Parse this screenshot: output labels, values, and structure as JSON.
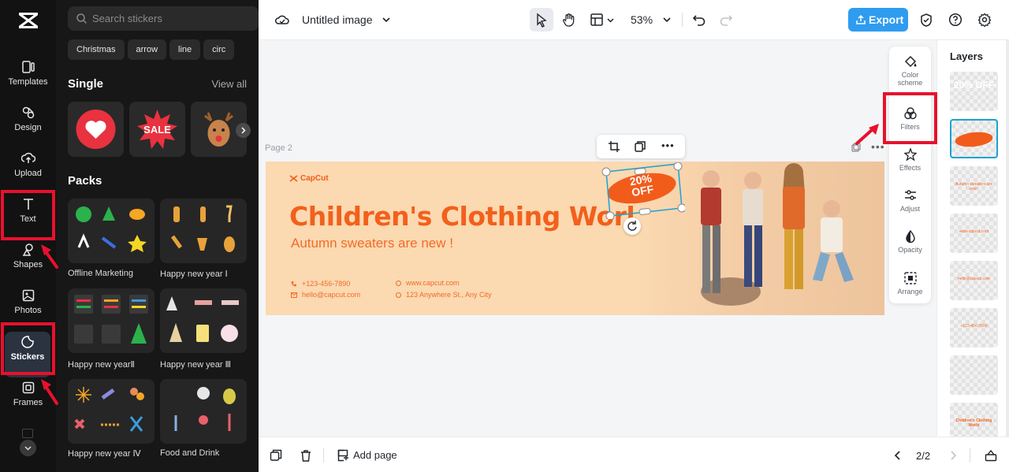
{
  "left_rail": {
    "items": [
      {
        "key": "templates",
        "label": "Templates"
      },
      {
        "key": "design",
        "label": "Design"
      },
      {
        "key": "upload",
        "label": "Upload"
      },
      {
        "key": "text",
        "label": "Text"
      },
      {
        "key": "shapes",
        "label": "Shapes"
      },
      {
        "key": "photos",
        "label": "Photos"
      },
      {
        "key": "stickers",
        "label": "Stickers"
      },
      {
        "key": "frames",
        "label": "Frames"
      }
    ],
    "active": "stickers"
  },
  "sticker_panel": {
    "search_placeholder": "Search stickers",
    "chips": [
      "Christmas",
      "arrow",
      "line",
      "circ"
    ],
    "single_title": "Single",
    "view_all": "View all",
    "single_items": [
      {
        "name": "heart-sticker",
        "text": ""
      },
      {
        "name": "sale-sticker",
        "text": "SALE"
      },
      {
        "name": "reindeer-sticker",
        "text": ""
      }
    ],
    "packs_title": "Packs",
    "packs": [
      {
        "label": "Offline Marketing"
      },
      {
        "label": "Happy new year Ⅰ"
      },
      {
        "label": "Happy new yearⅡ"
      },
      {
        "label": "Happy new year Ⅲ"
      },
      {
        "label": "Happy new year Ⅳ"
      },
      {
        "label": "Food and Drink"
      }
    ]
  },
  "topbar": {
    "title": "Untitled image",
    "zoom": "53%",
    "export_label": "Export"
  },
  "canvas": {
    "page_label": "Page 2",
    "banner": {
      "brand": "CapCut",
      "headline": "Children's Clothing World",
      "subline": "Autumn sweaters are new !",
      "phone": "+123-456-7890",
      "email": "hello@capcut.com",
      "website": "www.capcut.com",
      "address": "123 Anywhere St., Any City",
      "badge_line1": "20%",
      "badge_line2": "OFF"
    }
  },
  "tools": [
    {
      "key": "color-scheme",
      "label": "Color scheme"
    },
    {
      "key": "filters",
      "label": "Filters"
    },
    {
      "key": "effects",
      "label": "Effects"
    },
    {
      "key": "adjust",
      "label": "Adjust"
    },
    {
      "key": "opacity",
      "label": "Opacity"
    },
    {
      "key": "arrange",
      "label": "Arrange"
    }
  ],
  "layers": {
    "title": "Layers",
    "items": [
      {
        "text": "20% OFF"
      },
      {
        "text": ""
      },
      {
        "text": "Autumn sweaters are new !"
      },
      {
        "text": "www.capcut.com"
      },
      {
        "text": "hello@capcut.com"
      },
      {
        "text": "+123-456-7890"
      },
      {
        "text": ""
      },
      {
        "text": "Children's Clothing World"
      }
    ],
    "selected_index": 1
  },
  "bottombar": {
    "add_page": "Add page",
    "page_count": "2/2"
  },
  "colors": {
    "accent_orange": "#f2601c",
    "banner_bg": "#fbd9b1",
    "export_blue": "#2f9cf0",
    "annotation_red": "#e8112d"
  }
}
